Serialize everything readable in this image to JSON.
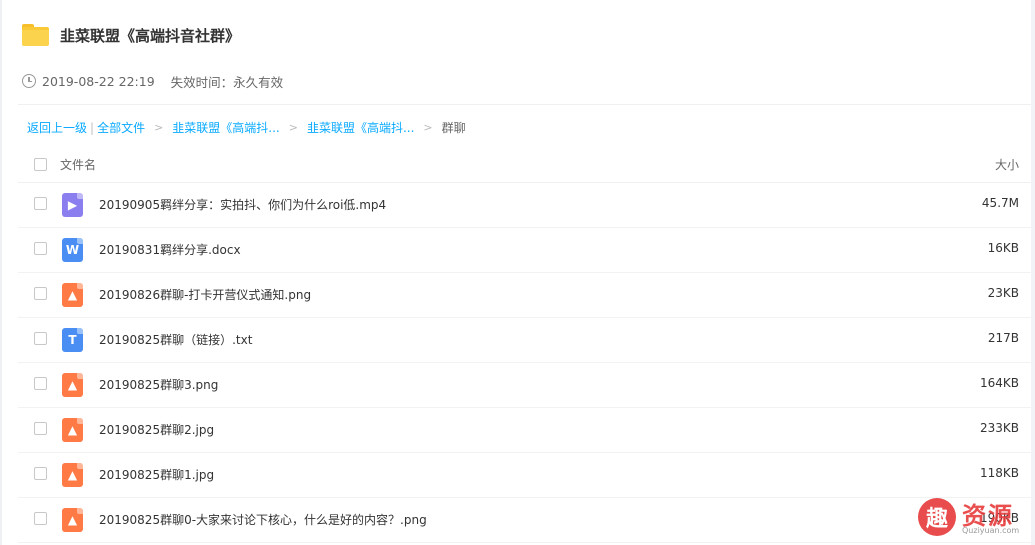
{
  "share": {
    "title": "韭菜联盟《高端抖音社群》",
    "date": "2019-08-22 22:19",
    "expire_label": "失效时间：",
    "expire_value": "永久有效"
  },
  "breadcrumb": {
    "back": "返回上一级",
    "all_files": "全部文件",
    "crumb1": "韭菜联盟《高端抖...",
    "crumb2": "韭菜联盟《高端抖...",
    "current": "群聊",
    "separator": ">"
  },
  "table": {
    "col_name": "文件名",
    "col_size": "大小",
    "rows": [
      {
        "name": "20190905羁绊分享：实拍抖、你们为什么roi低.mp4",
        "size": "45.7M",
        "icon": "video-file-icon"
      },
      {
        "name": "20190831羁绊分享.docx",
        "size": "16KB",
        "icon": "word-file-icon"
      },
      {
        "name": "20190826群聊-打卡开营仪式通知.png",
        "size": "23KB",
        "icon": "image-file-icon"
      },
      {
        "name": "20190825群聊（链接）.txt",
        "size": "217B",
        "icon": "text-file-icon"
      },
      {
        "name": "20190825群聊3.png",
        "size": "164KB",
        "icon": "image-file-icon"
      },
      {
        "name": "20190825群聊2.jpg",
        "size": "233KB",
        "icon": "image-file-icon"
      },
      {
        "name": "20190825群聊1.jpg",
        "size": "118KB",
        "icon": "image-file-icon"
      },
      {
        "name": "20190825群聊0-大家来讨论下核心，什么是好的内容？.png",
        "size": "190KB",
        "icon": "image-file-icon"
      }
    ]
  },
  "icons": {
    "video_glyph": "▶",
    "word_glyph": "W",
    "text_glyph": "T",
    "image_glyph": "▲"
  },
  "watermark": {
    "badge": "趣",
    "text": "资源",
    "url": "Quziyuan.com"
  },
  "colors": {
    "link": "#09aaff",
    "folder": "#fcd34d",
    "video": "#8b7ff0",
    "word": "#4a8ef4",
    "image": "#ff7a45",
    "watermark": "#e83d3d"
  }
}
